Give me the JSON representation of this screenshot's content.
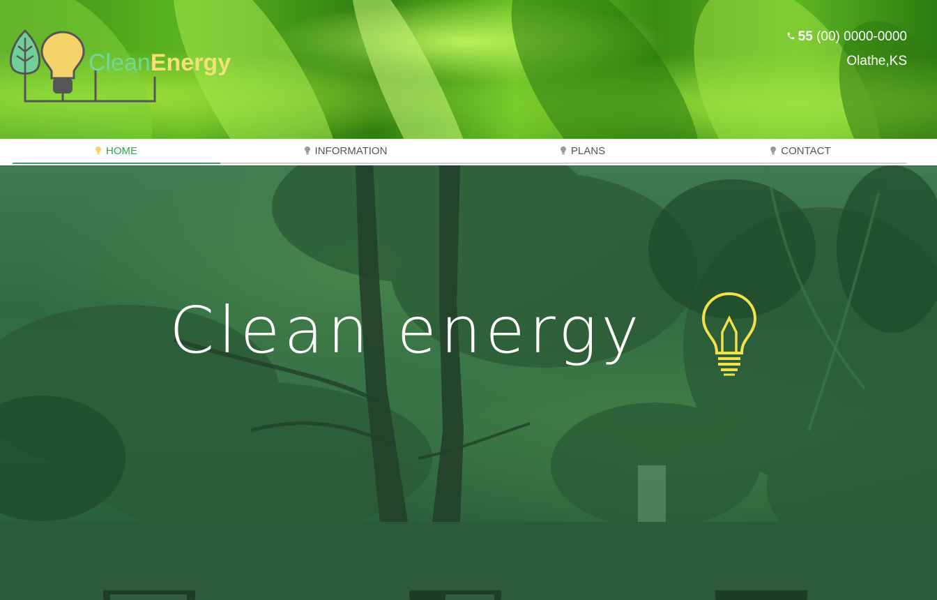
{
  "brand": {
    "name_part1": "Clean",
    "name_part2": "Energy",
    "colors": {
      "clean": "#6fd6a0",
      "energy": "#f2e07a",
      "bulb": "#f4d36a",
      "leaf": "#6fcf97"
    }
  },
  "contact": {
    "phone_icon": "phone-icon",
    "phone_prefix": "55",
    "phone_number": "(00) 0000-0000",
    "location": "Olathe,KS"
  },
  "nav": {
    "items": [
      {
        "label": "HOME",
        "active": true
      },
      {
        "label": "INFORMATION",
        "active": false
      },
      {
        "label": "PLANS",
        "active": false
      },
      {
        "label": "CONTACT",
        "active": false
      }
    ],
    "active_color": "#3aa05a"
  },
  "hero": {
    "title": "Clean energy",
    "icon": "lightbulb-icon",
    "icon_color": "#f2e24a"
  }
}
